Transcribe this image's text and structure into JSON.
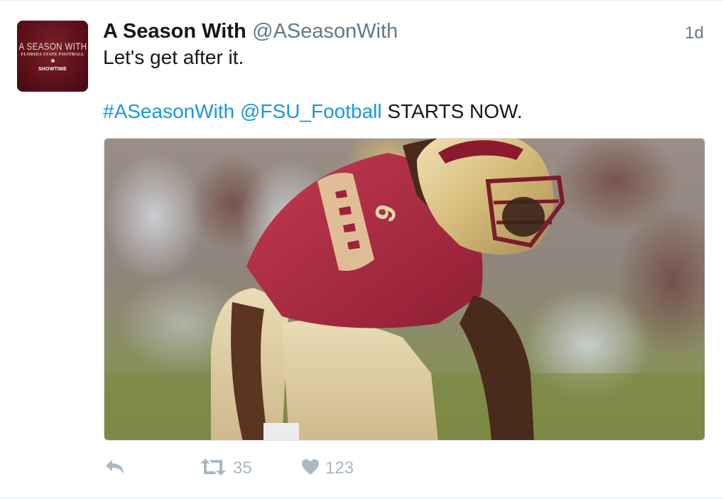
{
  "avatar": {
    "line1": "A SEASON WITH",
    "line2": "FLORIDA STATE FOOTBALL",
    "network": "SHOWTIME"
  },
  "tweet": {
    "display_name": "A Season With",
    "handle": "@ASeasonWith",
    "timestamp": "1d",
    "text_line1": "Let's get after it.",
    "hashtag": "#ASeasonWith",
    "mention": "@FSU_Football",
    "text_rest": " STARTS NOW.",
    "media_description": "football player in garnet jersey number 9 with gold helmet in stance"
  },
  "actions": {
    "reply_icon": "reply-icon",
    "retweet_icon": "retweet-icon",
    "retweet_count": "35",
    "like_icon": "heart-icon",
    "like_count": "123"
  },
  "colors": {
    "link": "#1b95e0",
    "secondary_text": "#657786",
    "action_icons": "#aab8c2",
    "avatar_bg": "#5a1019"
  }
}
